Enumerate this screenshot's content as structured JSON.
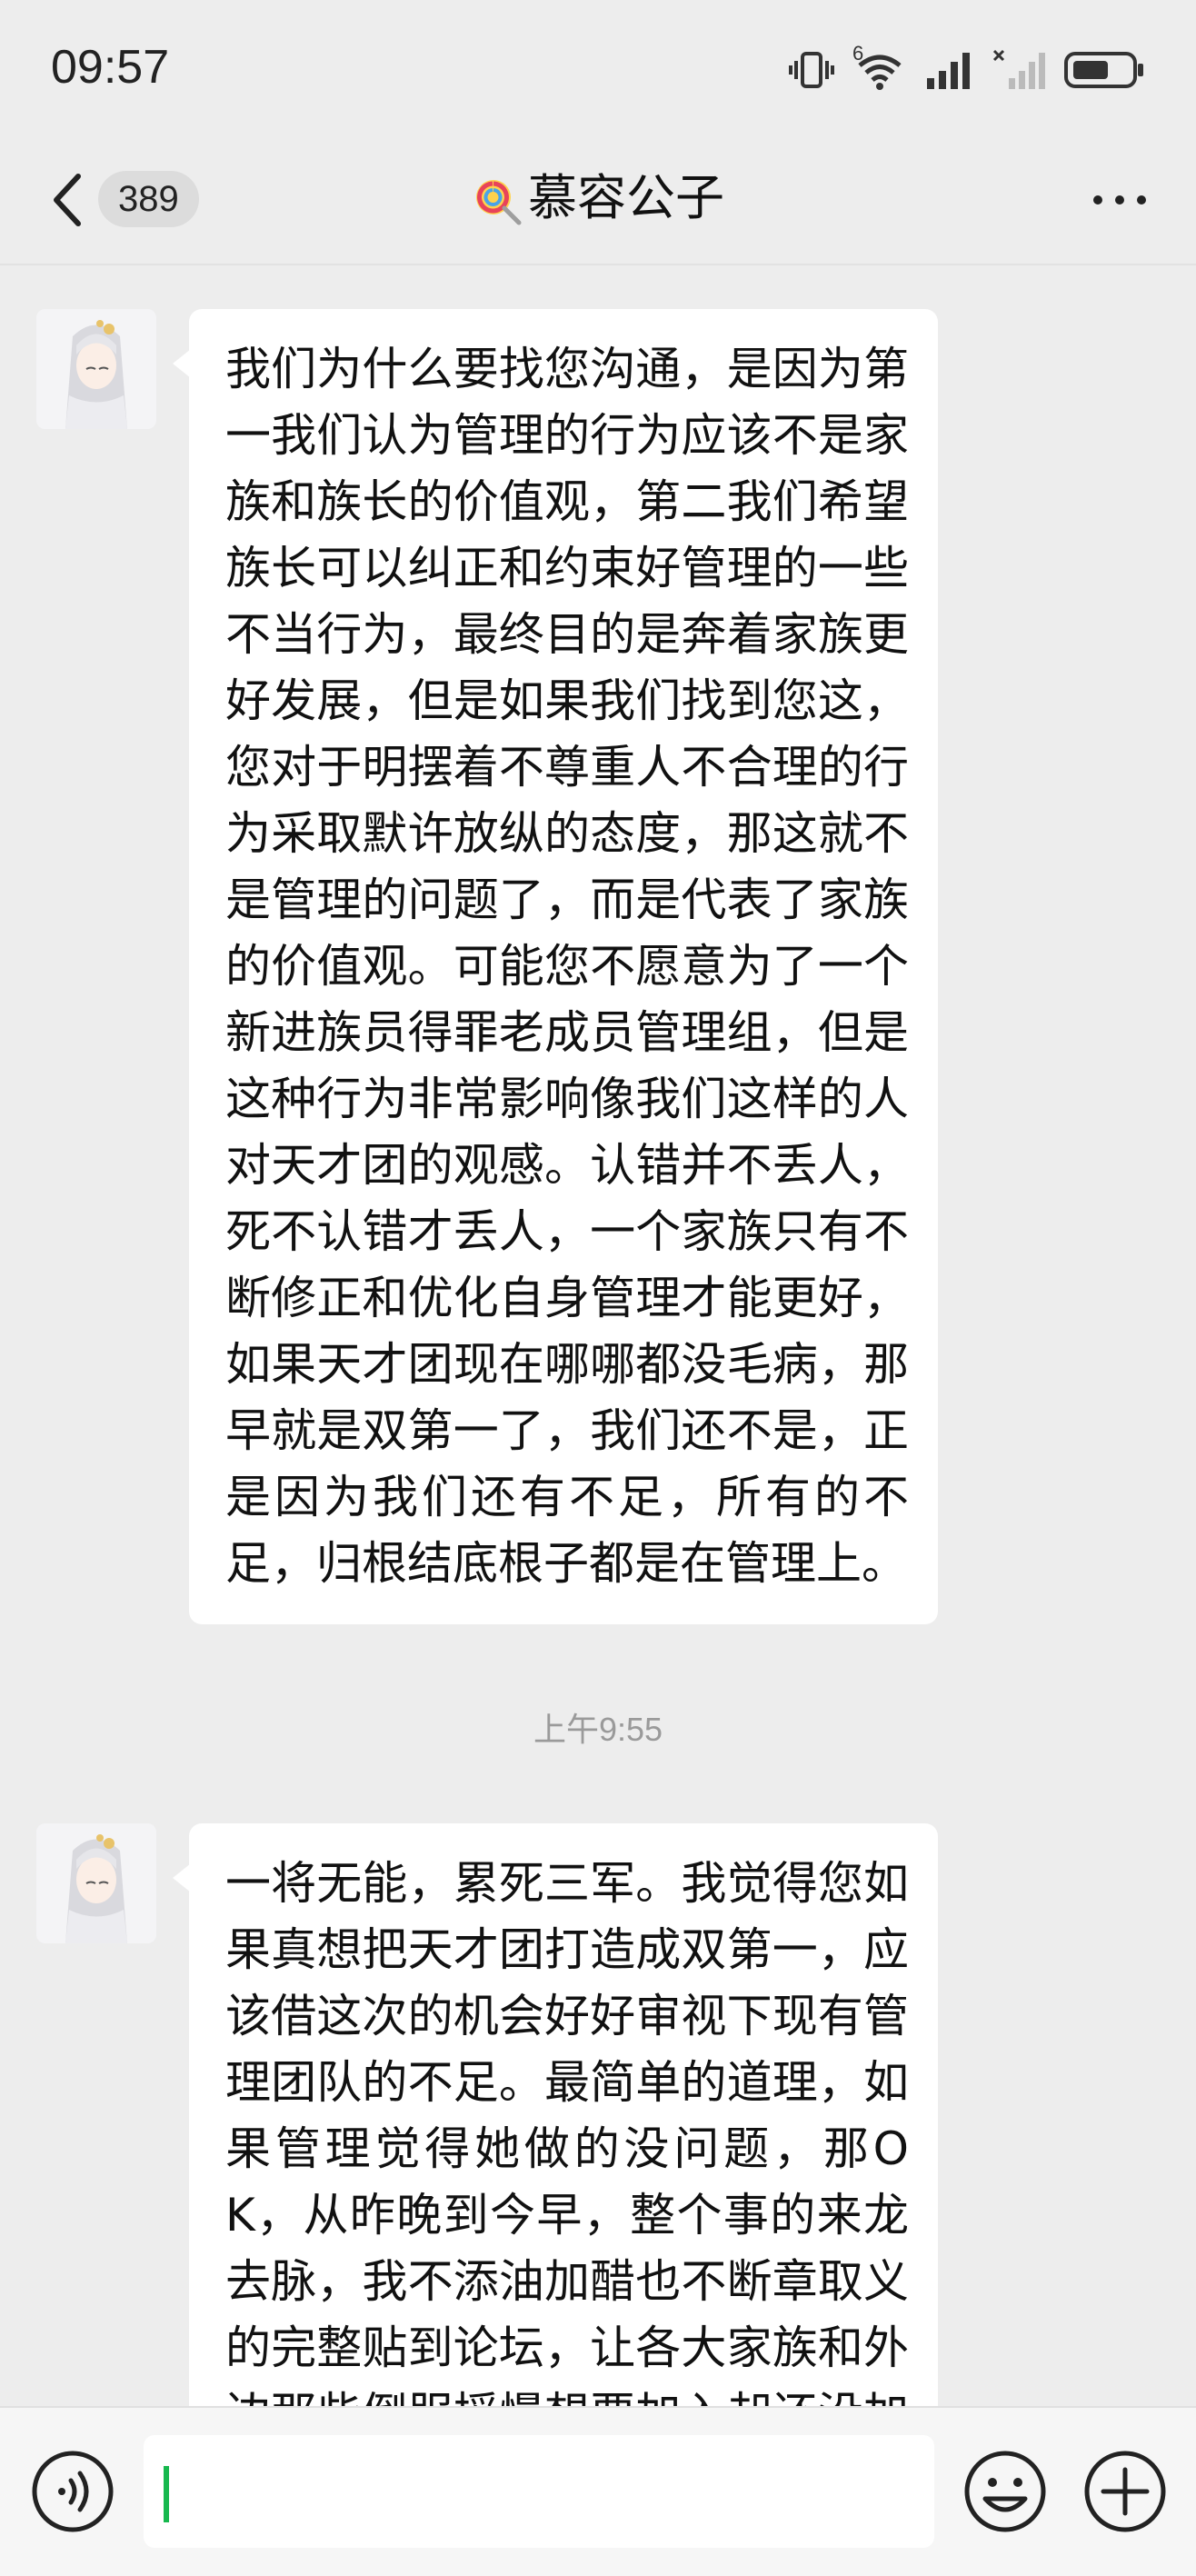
{
  "status_bar": {
    "time": "09:57",
    "network_label": "6"
  },
  "nav": {
    "unread_count": "389",
    "chat_title": "慕容公子"
  },
  "messages": [
    {
      "text": "我们为什么要找您沟通，是因为第一我们认为管理的行为应该不是家族和族长的价值观，第二我们希望族长可以纠正和约束好管理的一些不当行为，最终目的是奔着家族更好发展，但是如果我们找到您这，您对于明摆着不尊重人不合理的行为采取默许放纵的态度，那这就不是管理的问题了，而是代表了家族的价值观。可能您不愿意为了一个新进族员得罪老成员管理组，但是这种行为非常影响像我们这样的人对天才团的观感。认错并不丢人，死不认错才丢人，一个家族只有不断修正和优化自身管理才能更好，如果天才团现在哪哪都没毛病，那早就是双第一了，我们还不是，正是因为我们还有不足，所有的不足，归根结底根子都是在管理上。"
    },
    {
      "text": "一将无能，累死三军。我觉得您如果真想把天才团打造成双第一，应该借这次的机会好好审视下现有管理团队的不足。最简单的道理，如果管理觉得她做的没问题，那OK，从昨晚到今早，整个事的来龙去脉，我不添油加醋也不断章取义的完整贴到论坛，让各大家族和外边那些倒服摇慢想要加入却还没加入"
    }
  ],
  "timestamp": "上午9:55",
  "colors": {
    "background": "#ededed",
    "bubble": "#ffffff",
    "caret": "#17b84e"
  }
}
